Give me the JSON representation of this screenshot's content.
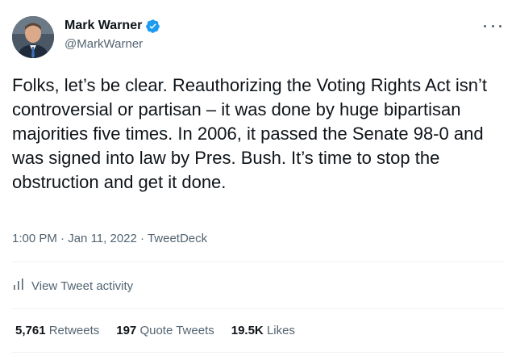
{
  "author": {
    "display_name": "Mark Warner",
    "handle": "@MarkWarner",
    "verified": true
  },
  "tweet": {
    "text": "Folks, let’s be clear. Reauthorizing the Voting Rights Act isn’t controversial or partisan – it was done by huge bipartisan majorities five times. In 2006, it passed the Senate 98-0 and was signed into law by Pres. Bush. It’s time to stop the obstruction and get it done.",
    "time": "1:00 PM",
    "separator": "·",
    "date": "Jan 11, 2022",
    "source": "TweetDeck"
  },
  "activity": {
    "label": "View Tweet activity",
    "icon": "bar-chart-icon"
  },
  "stats": {
    "retweets_count": "5,761",
    "retweets_label": "Retweets",
    "quote_count": "197",
    "quote_label": "Quote Tweets",
    "likes_count": "19.5K",
    "likes_label": "Likes"
  },
  "colors": {
    "text_primary": "#0f1419",
    "text_secondary": "#536471",
    "verified_blue": "#1d9bf0",
    "divider": "#eff3f4"
  }
}
